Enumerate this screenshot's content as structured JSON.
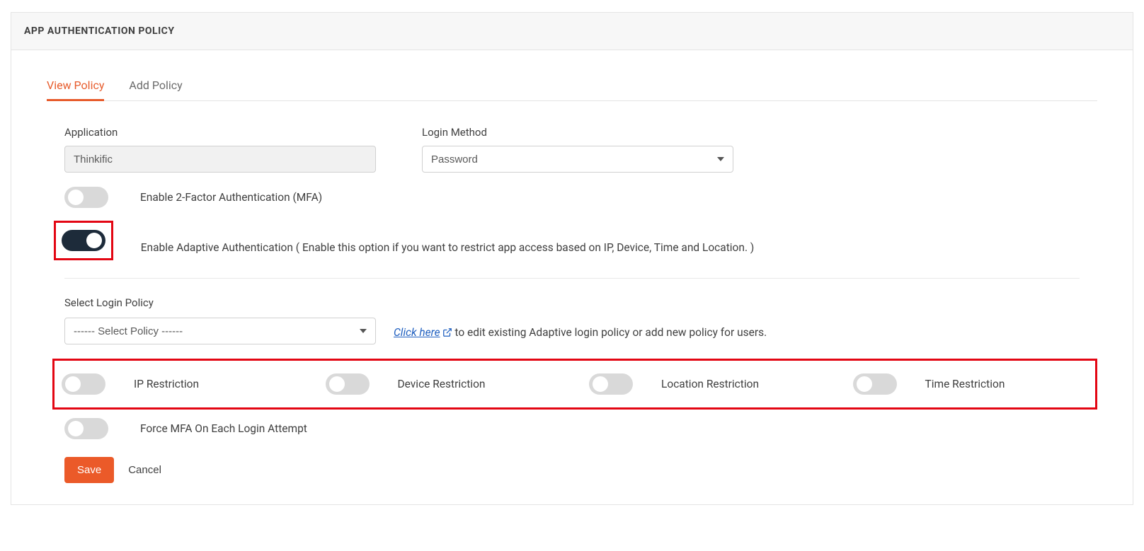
{
  "header": {
    "title": "APP AUTHENTICATION POLICY"
  },
  "tabs": {
    "view": "View Policy",
    "add": "Add Policy"
  },
  "form": {
    "application_label": "Application",
    "application_value": "Thinkific",
    "login_method_label": "Login Method",
    "login_method_value": "Password",
    "mfa_label": "Enable 2-Factor Authentication (MFA)",
    "adaptive_label": "Enable Adaptive Authentication ( Enable this option if you want to restrict app access based on IP, Device, Time and Location. )",
    "select_policy_label": "Select Login Policy",
    "select_policy_value": "------ Select Policy ------",
    "click_here": "Click here",
    "click_here_help": " to edit existing Adaptive login policy or add new policy for users.",
    "restrictions": {
      "ip": "IP Restriction",
      "device": "Device Restriction",
      "location": "Location Restriction",
      "time": "Time Restriction"
    },
    "force_mfa_label": "Force MFA On Each Login Attempt"
  },
  "actions": {
    "save": "Save",
    "cancel": "Cancel"
  }
}
